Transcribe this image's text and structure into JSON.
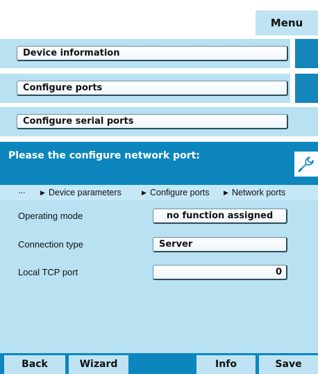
{
  "header": {
    "menu_label": "Menu"
  },
  "nav": [
    {
      "label": "Device information"
    },
    {
      "label": "Configure ports"
    },
    {
      "label": "Configure serial ports"
    }
  ],
  "panel": {
    "title": "Please the configure network port:",
    "tool_icon": "wrench-icon",
    "breadcrumb": {
      "ellipsis": "...",
      "items": [
        "Device parameters",
        "Configure ports",
        "Network ports"
      ]
    },
    "fields": [
      {
        "label": "Operating mode",
        "value": "no function assigned"
      },
      {
        "label": "Connection type",
        "value": "Server"
      },
      {
        "label": "Local TCP port",
        "value": "0"
      }
    ]
  },
  "footer": {
    "back": "Back",
    "wizard": "Wizard",
    "info": "Info",
    "save": "Save"
  },
  "colors": {
    "accent": "#0c86bd",
    "light": "#b8e1f2",
    "button_light": "#bfe3f3"
  }
}
